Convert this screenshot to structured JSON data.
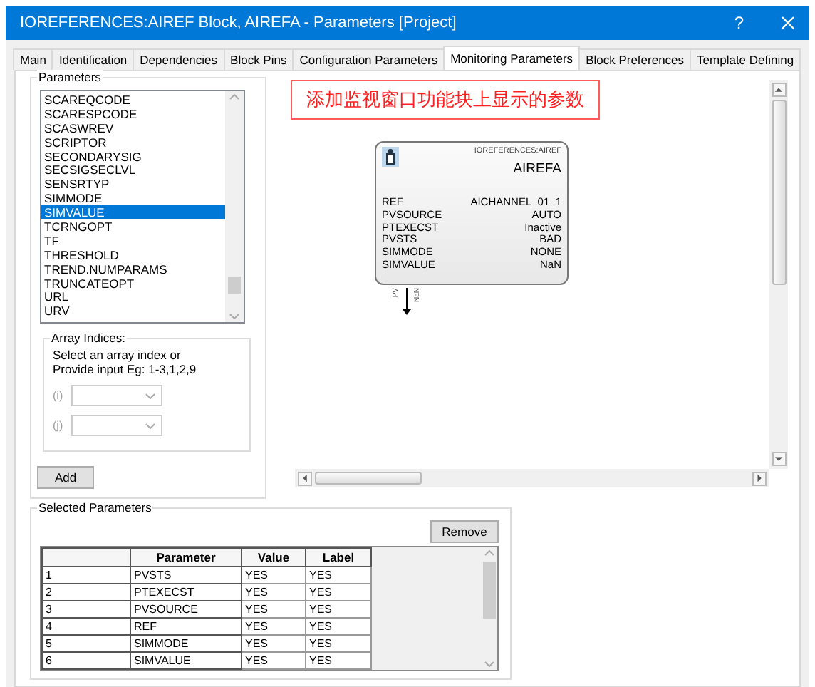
{
  "window": {
    "title": "IOREFERENCES:AIREF Block, AIREFA - Parameters [Project]",
    "help": "?"
  },
  "tabs": [
    {
      "label": "Main",
      "selected": false
    },
    {
      "label": "Identification",
      "selected": false
    },
    {
      "label": "Dependencies",
      "selected": false
    },
    {
      "label": "Block Pins",
      "selected": false
    },
    {
      "label": "Configuration Parameters",
      "selected": false
    },
    {
      "label": "Monitoring Parameters",
      "selected": true
    },
    {
      "label": "Block Preferences",
      "selected": false
    },
    {
      "label": "Template Defining",
      "selected": false
    }
  ],
  "parameters": {
    "title": "Parameters",
    "items": [
      {
        "label": "SCAREQCODE",
        "selected": false
      },
      {
        "label": "SCARESPCODE",
        "selected": false
      },
      {
        "label": "SCASWREV",
        "selected": false
      },
      {
        "label": "SCRIPTOR",
        "selected": false
      },
      {
        "label": "SECONDARYSIG",
        "selected": false
      },
      {
        "label": "SECSIGSECLVL",
        "selected": false
      },
      {
        "label": "SENSRTYP",
        "selected": false
      },
      {
        "label": "SIMMODE",
        "selected": false
      },
      {
        "label": "SIMVALUE",
        "selected": true
      },
      {
        "label": "TCRNGOPT",
        "selected": false
      },
      {
        "label": "TF",
        "selected": false
      },
      {
        "label": "THRESHOLD",
        "selected": false
      },
      {
        "label": "TREND.NUMPARAMS",
        "selected": false
      },
      {
        "label": "TRUNCATEOPT",
        "selected": false
      },
      {
        "label": "URL",
        "selected": false
      },
      {
        "label": "URV",
        "selected": false
      }
    ],
    "array_indices": {
      "title": "Array Indices:",
      "hint": "Select an array index or Provide input Eg: 1-3,1,2,9",
      "fields": [
        {
          "label": "(i)",
          "disabled": true
        },
        {
          "label": "(j)",
          "disabled": true
        }
      ]
    },
    "add_button": "Add"
  },
  "canvas": {
    "note": "添加监视窗口功能块上显示的参数",
    "block": {
      "type_label": "IOREFERENCES:AIREF",
      "name": "AIREFA",
      "params": [
        {
          "name": "REF",
          "value": "AICHANNEL_01_1"
        },
        {
          "name": "PVSOURCE",
          "value": "AUTO"
        },
        {
          "name": "PTEXECST",
          "value": "Inactive"
        },
        {
          "name": "PVSTS",
          "value": "BAD"
        },
        {
          "name": "SIMMODE",
          "value": "NONE"
        },
        {
          "name": "SIMVALUE",
          "value": "NaN"
        }
      ],
      "pins": [
        "PV",
        "NaN"
      ]
    }
  },
  "selected_parameters": {
    "title": "Selected Parameters",
    "remove_button": "Remove",
    "columns": [
      "",
      "Parameter",
      "Value",
      "Label"
    ],
    "rows": [
      [
        "1",
        "PVSTS",
        "YES",
        "YES"
      ],
      [
        "2",
        "PTEXECST",
        "YES",
        "YES"
      ],
      [
        "3",
        "PVSOURCE",
        "YES",
        "YES"
      ],
      [
        "4",
        "REF",
        "YES",
        "YES"
      ],
      [
        "5",
        "SIMMODE",
        "YES",
        "YES"
      ],
      [
        "6",
        "SIMVALUE",
        "YES",
        "YES"
      ]
    ]
  }
}
